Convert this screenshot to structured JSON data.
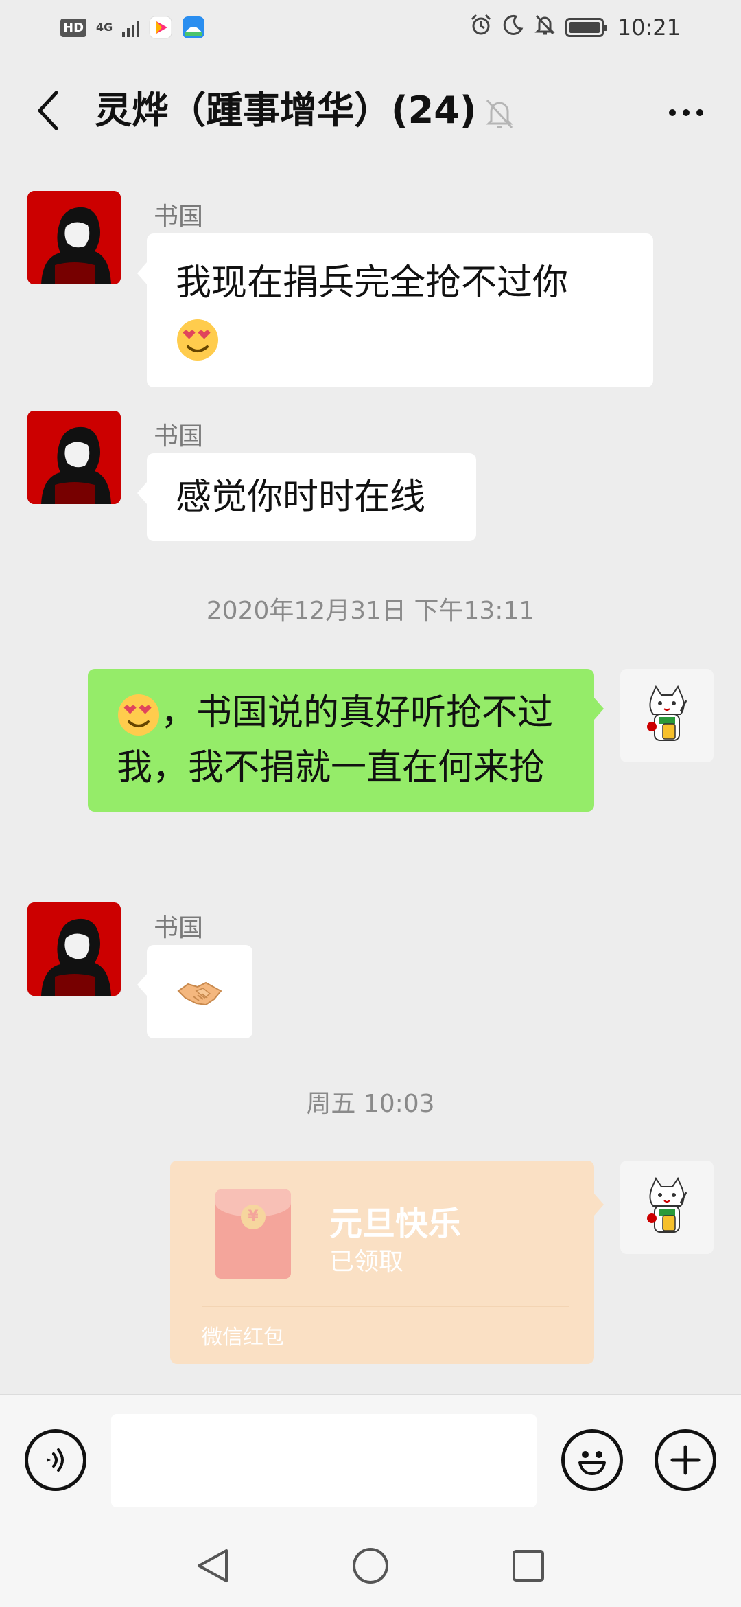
{
  "status_bar": {
    "hd": "HD",
    "network": "4G",
    "time": "10:21",
    "icons": [
      "signal-icon",
      "video-app-icon",
      "mail-app-icon",
      "alarm-icon",
      "moon-icon",
      "bell-off-icon",
      "battery-icon"
    ]
  },
  "header": {
    "title": "灵烨（踵事增华）(24)",
    "icons": [
      "back-icon",
      "mute-icon",
      "more-icon"
    ]
  },
  "messages": [
    {
      "sender": "书国",
      "text": "我现在捐兵完全抢不过你",
      "emoji": "smiling-face-with-heart-eyes"
    },
    {
      "sender": "书国",
      "text": "感觉你时时在线"
    },
    {
      "timestamp": "2020年12月31日 下午13:11"
    },
    {
      "self": true,
      "text": "，书国说的真好听抢不过我，我不捐就一直在何来抢",
      "emoji": "smiling-face-with-heart-eyes"
    },
    {
      "sender": "书国",
      "emoji": "handshake"
    },
    {
      "timestamp": "周五 10:03"
    },
    {
      "self": true,
      "red_packet": {
        "title": "元旦快乐",
        "status": "已领取",
        "label": "微信红包"
      }
    }
  ],
  "colors": {
    "background": "#ededed",
    "self_bubble": "#95ec69",
    "red_packet": "#fae0c4",
    "avatar_red": "#c80000"
  },
  "input_bar": {
    "icons": [
      "voice-icon",
      "emoji-icon",
      "plus-icon"
    ]
  },
  "nav_bar": {
    "icons": [
      "nav-back-icon",
      "nav-home-icon",
      "nav-recents-icon"
    ]
  }
}
